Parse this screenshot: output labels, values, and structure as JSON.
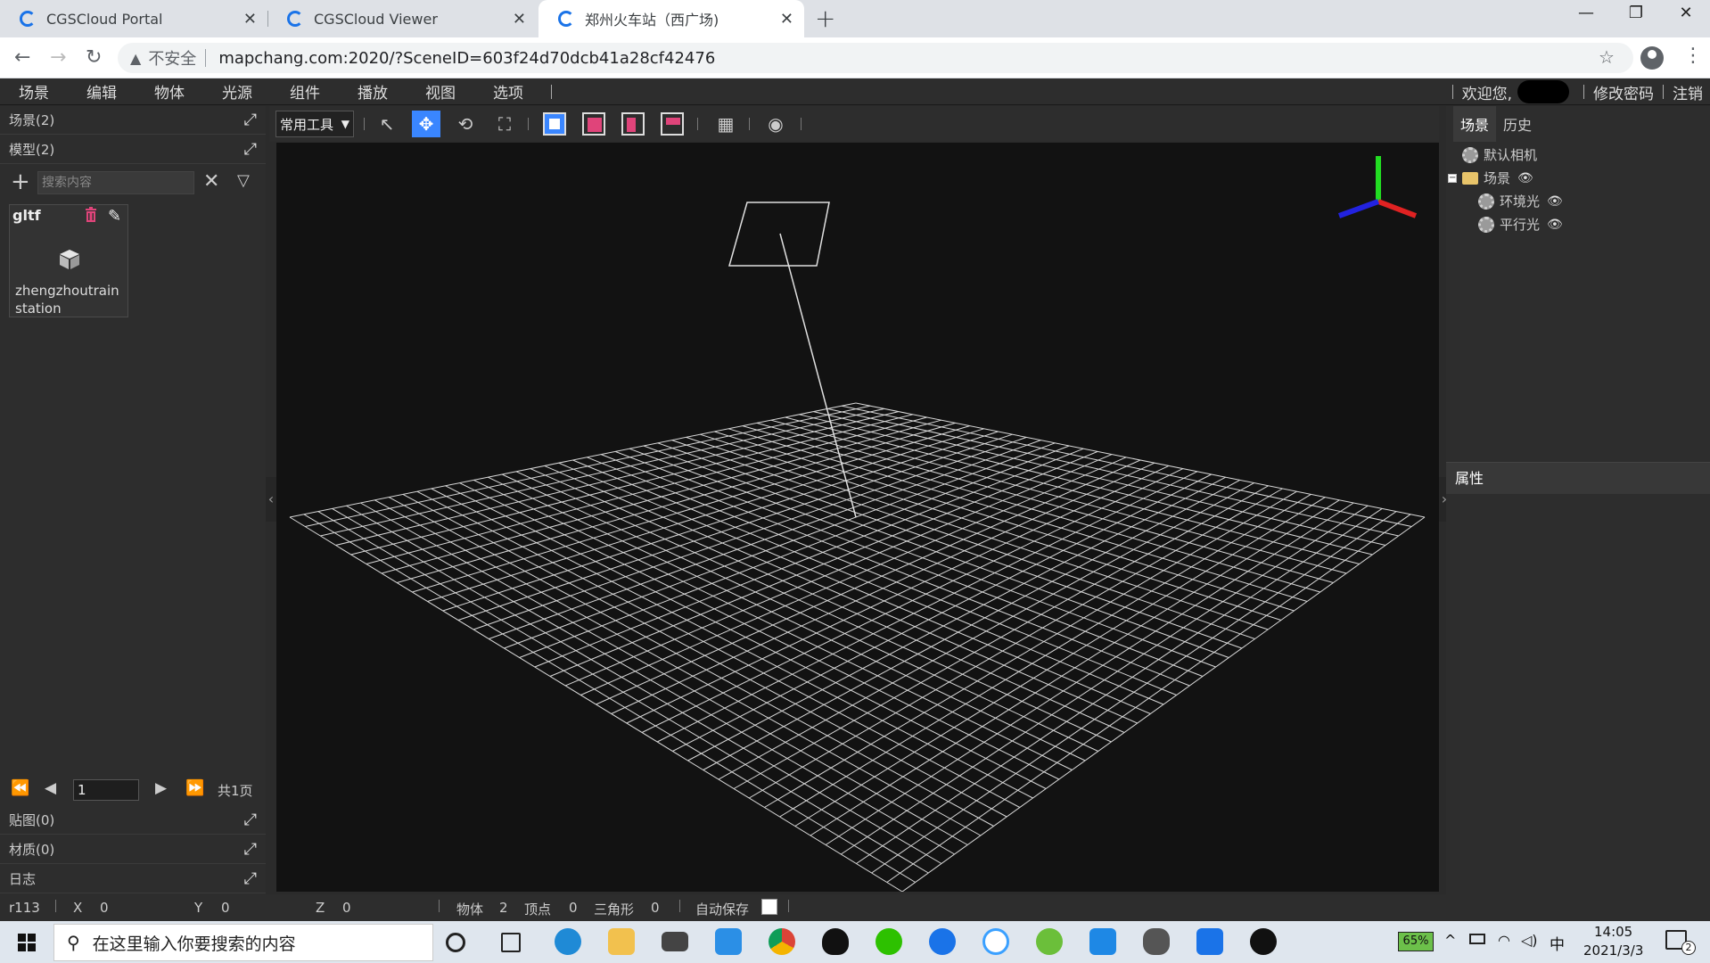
{
  "browser": {
    "tabs": [
      {
        "title": "CGSCloud Portal",
        "active": false
      },
      {
        "title": "CGSCloud Viewer",
        "active": false
      },
      {
        "title": "郑州火车站（西广场)",
        "active": true
      }
    ],
    "new_tab": "+",
    "window_controls": {
      "minimize": "—",
      "restore": "❐",
      "close": "✕"
    },
    "address": {
      "security_label": "不安全",
      "url": "mapchang.com:2020/?SceneID=603f24d70dcb41a28cf42476"
    }
  },
  "menu": {
    "items": [
      "场景",
      "编辑",
      "物体",
      "光源",
      "组件",
      "播放",
      "视图",
      "选项"
    ],
    "welcome": "欢迎您,",
    "change_password": "修改密码",
    "logout": "注销"
  },
  "left_panel": {
    "scene_header": "场景(2)",
    "model_header": "模型(2)",
    "search_placeholder": "搜索内容",
    "card": {
      "title": "gltf",
      "name": "zhengzhoutrain station"
    },
    "pager": {
      "page": "1",
      "total": "共1页"
    },
    "texture_header": "贴图(0)",
    "material_header": "材质(0)",
    "log_header": "日志"
  },
  "toolbar": {
    "tool_select": "常用工具",
    "icons": [
      "select-icon",
      "move-icon",
      "rotate-icon",
      "scale-icon",
      "view-front-icon",
      "view-side-icon",
      "view-back-icon",
      "view-top-icon",
      "grid-icon",
      "view-eye-icon"
    ],
    "active_tool": "move-icon"
  },
  "right_panel": {
    "tabs": [
      "场景",
      "历史"
    ],
    "active_tab": "场景",
    "tree": [
      {
        "label": "默认相机",
        "type": "camera",
        "eye": false
      },
      {
        "label": "场景",
        "type": "folder",
        "eye": true
      },
      {
        "label": "环境光",
        "type": "light",
        "eye": true
      },
      {
        "label": "平行光",
        "type": "light",
        "eye": true
      }
    ],
    "properties_header": "属性"
  },
  "status": {
    "version": "r113",
    "x_label": "X",
    "x_value": "0",
    "y_label": "Y",
    "y_value": "0",
    "z_label": "Z",
    "z_value": "0",
    "objects_label": "物体",
    "objects_value": "2",
    "vertices_label": "顶点",
    "vertices_value": "0",
    "triangles_label": "三角形",
    "triangles_value": "0",
    "autosave_label": "自动保存"
  },
  "taskbar": {
    "search_placeholder": "在这里输入你要搜索的内容",
    "battery": "65%",
    "ime": "中",
    "time": "14:05",
    "date": "2021/3/3",
    "notifications": "2",
    "apps": [
      "cortana-icon",
      "task-view-icon",
      "edge-icon",
      "file-explorer-icon",
      "mail-icon",
      "vscode-icon",
      "chrome-icon",
      "qq-icon",
      "wechat-icon",
      "feishu-icon",
      "baidu-netdisk-icon",
      "qgis-icon",
      "photos-icon",
      "game-controller-icon",
      "music-icon",
      "xbox-icon"
    ]
  },
  "colors": {
    "accent": "#3a86ff",
    "viewport_bg": "#121212",
    "panel_bg": "#2d2d2d",
    "face_pink": "#e0447a"
  }
}
